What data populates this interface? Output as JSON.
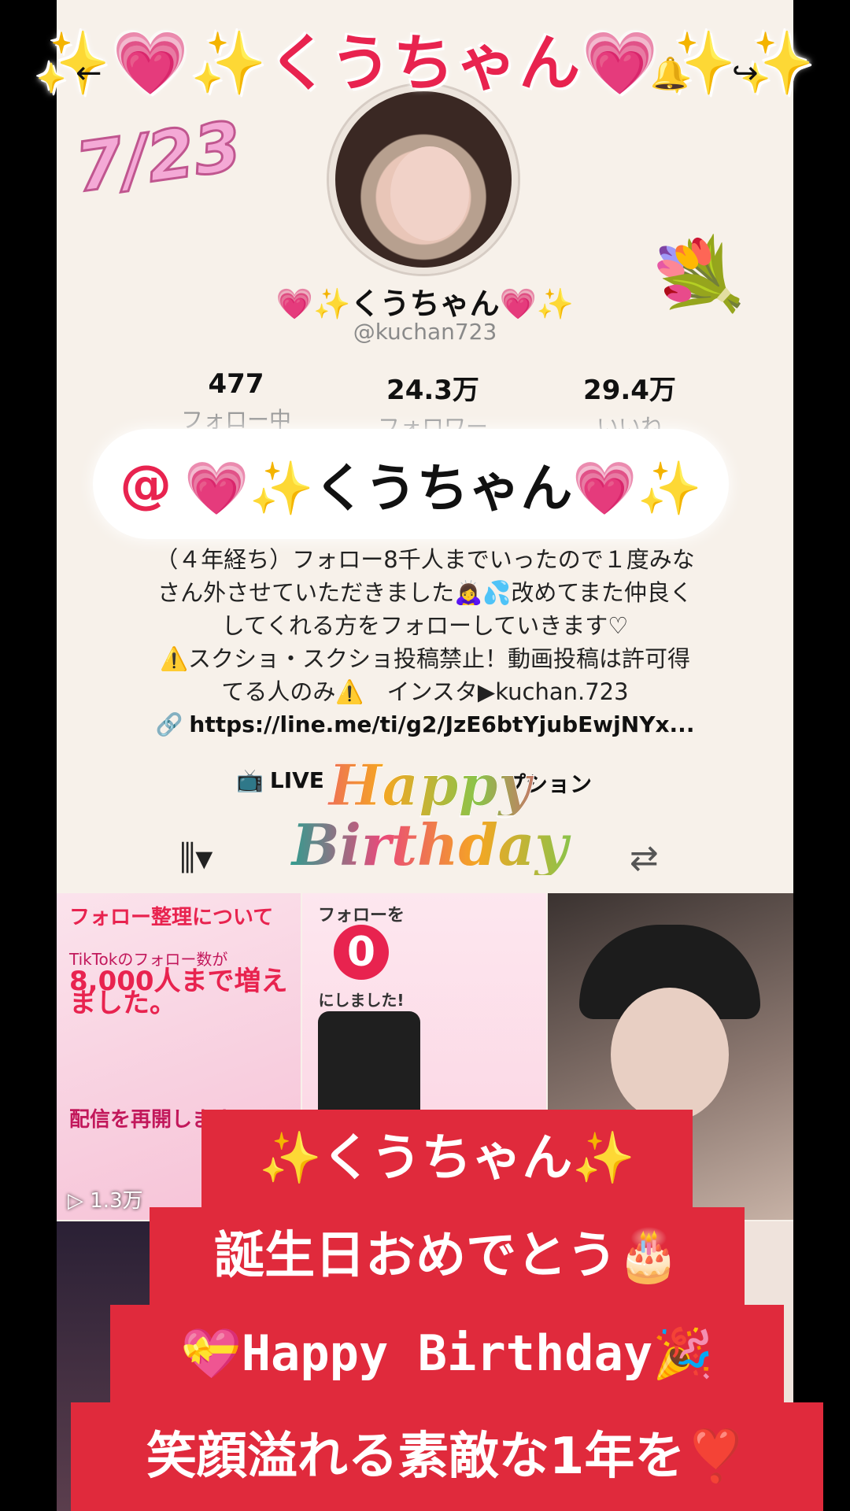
{
  "title_banner": "✨💗✨くうちゃん💗✨✨",
  "nav": {
    "back_icon": "back-arrow-icon",
    "bell_icon": "bell-icon",
    "share_icon": "share-icon"
  },
  "date_stamp": "7/23",
  "profile": {
    "display_name": "💗✨くうちゃん💗✨",
    "handle": "@kuchan723",
    "stats": [
      {
        "value": "477",
        "label": "フォロー中"
      },
      {
        "value": "24.3万",
        "label": "フォロワー"
      },
      {
        "value": "29.4万",
        "label": "いいね"
      }
    ],
    "name_pill": {
      "at": "@",
      "text": "💗✨くうちゃん💗✨"
    },
    "bio_lines": [
      "（４年経ち）フォロー8千人までいったので１度みな",
      "さん外させていただきました🙇‍♀️💦改めてまた仲良く",
      "してくれる方をフォローしていきます♡",
      "⚠️スクショ・スクショ投稿禁止！動画投稿は許可得",
      "てる人のみ⚠️　インスタ▶kuchan.723"
    ],
    "link": "https://line.me/ti/g2/JzE6btYjubEwjNYx...",
    "live_label": "LIVE",
    "subscription_label": "プション"
  },
  "sticker": {
    "line1": "Happy",
    "line2": "Birthday"
  },
  "grid": {
    "tile1": {
      "heading": "フォロー整理について",
      "body": "TikTokのフォロー数が",
      "number": "8,000人まで増えました。",
      "footer": "配信を再開します！",
      "views": "▷ 1.3万"
    },
    "tile2": {
      "heading": "フォローを",
      "zero": "0",
      "sub": "にしました!"
    }
  },
  "ribbons": [
    "✨くうちゃん✨",
    "誕生日おめでとう🎂",
    "💝Happy Birthday🎉",
    "笑顔溢れる素敵な1年を❣️"
  ]
}
